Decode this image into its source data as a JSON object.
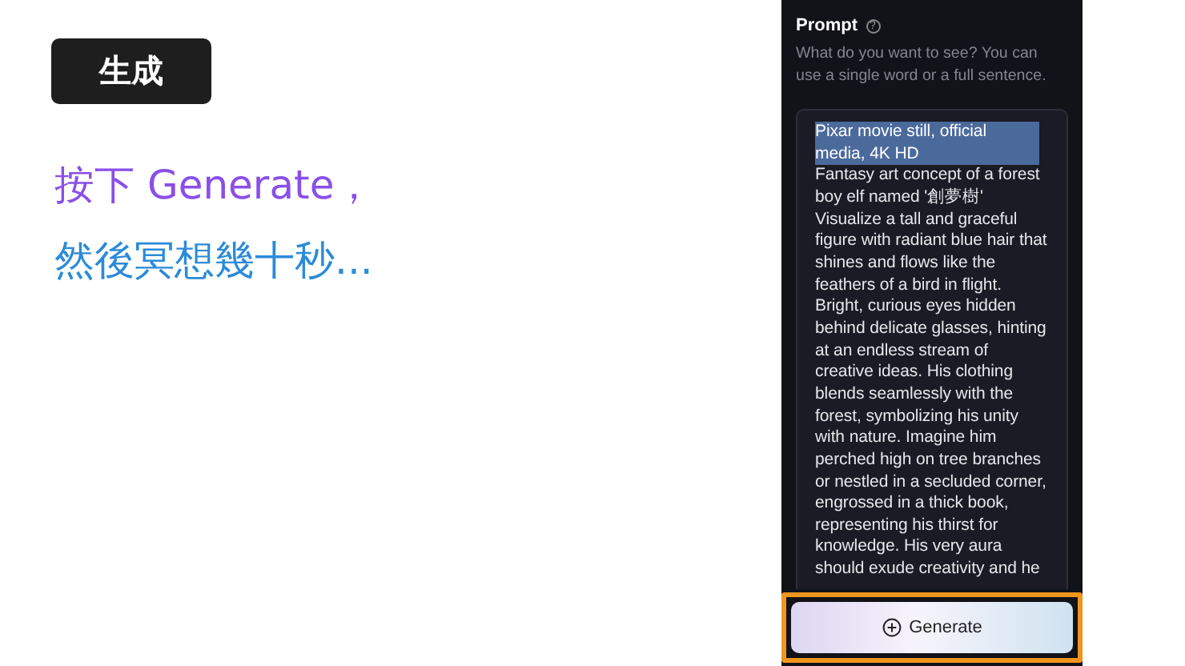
{
  "slide": {
    "badge": "生成",
    "lines": [
      {
        "text": "按下 Generate，",
        "color": "#8a4fe8"
      },
      {
        "text": "然後冥想幾十秒...",
        "color": "#2b8bd9"
      }
    ]
  },
  "panel": {
    "title": "Prompt",
    "help_icon": "?",
    "description": "What do you want to see? You can use a single word or a full sentence.",
    "prompt": {
      "selected_text": "Pixar movie still, official media, 4K HD",
      "text": "Fantasy art concept of a forest boy elf named '創夢樹' Visualize a tall and graceful figure with radiant blue hair that shines and flows like the feathers of a bird in flight. Bright, curious eyes hidden behind delicate glasses, hinting at an endless stream of creative ideas. His clothing blends seamlessly with the forest, symbolizing his unity with nature. Imagine him perched high on tree branches or nestled in a secluded corner, engrossed in a thick book, representing his thirst for knowledge. His very aura should exude creativity and he"
    },
    "button": {
      "label": "Generate",
      "highlighted": true
    }
  }
}
